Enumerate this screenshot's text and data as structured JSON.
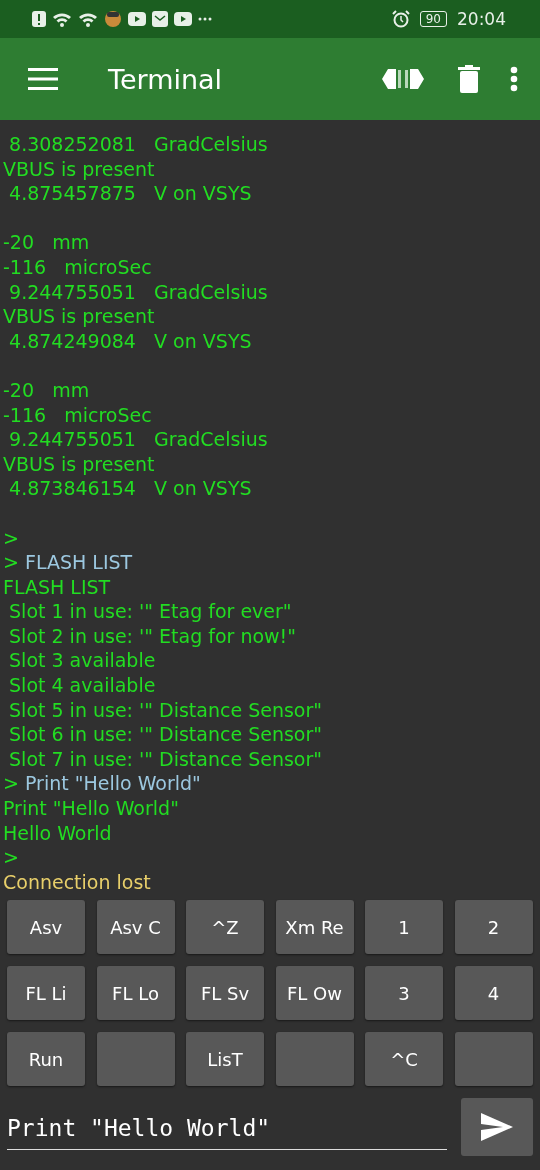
{
  "status_bar": {
    "time": "20:04",
    "battery": "90"
  },
  "app_bar": {
    "title": "Terminal"
  },
  "terminal": {
    "lines": [
      {
        "kind": "received",
        "text": " 8.308252081   GradCelsius"
      },
      {
        "kind": "received",
        "text": "VBUS is present"
      },
      {
        "kind": "received",
        "text": " 4.875457875   V on VSYS"
      },
      {
        "kind": "blank"
      },
      {
        "kind": "received",
        "text": "-20   mm"
      },
      {
        "kind": "received",
        "text": "-116   microSec"
      },
      {
        "kind": "received",
        "text": " 9.244755051   GradCelsius"
      },
      {
        "kind": "received",
        "text": "VBUS is present"
      },
      {
        "kind": "received",
        "text": " 4.874249084   V on VSYS"
      },
      {
        "kind": "blank"
      },
      {
        "kind": "received",
        "text": "-20   mm"
      },
      {
        "kind": "received",
        "text": "-116   microSec"
      },
      {
        "kind": "received",
        "text": " 9.244755051   GradCelsius"
      },
      {
        "kind": "received",
        "text": "VBUS is present"
      },
      {
        "kind": "received",
        "text": " 4.873846154   V on VSYS"
      },
      {
        "kind": "blank"
      },
      {
        "kind": "received",
        "text": ">"
      },
      {
        "kind": "sent",
        "prompt": ">",
        "text": "FLASH LIST"
      },
      {
        "kind": "received",
        "text": "FLASH LIST"
      },
      {
        "kind": "received",
        "text": " Slot 1 in use: '\" Etag for ever\""
      },
      {
        "kind": "received",
        "text": " Slot 2 in use: '\" Etag for now!\""
      },
      {
        "kind": "received",
        "text": " Slot 3 available"
      },
      {
        "kind": "received",
        "text": " Slot 4 available"
      },
      {
        "kind": "received",
        "text": " Slot 5 in use: '\" Distance Sensor\""
      },
      {
        "kind": "received",
        "text": " Slot 6 in use: '\" Distance Sensor\""
      },
      {
        "kind": "received",
        "text": " Slot 7 in use: '\" Distance Sensor\""
      },
      {
        "kind": "sent",
        "prompt": ">",
        "text": "Print \"Hello World\""
      },
      {
        "kind": "received",
        "text": "Print \"Hello World\""
      },
      {
        "kind": "received",
        "text": "Hello World"
      },
      {
        "kind": "received",
        "text": ">"
      },
      {
        "kind": "status",
        "text": "Connection lost"
      }
    ]
  },
  "keys": [
    {
      "kind": "key",
      "label": "Asv"
    },
    {
      "kind": "key",
      "label": "Asv C"
    },
    {
      "kind": "key",
      "label": "^Z"
    },
    {
      "kind": "key",
      "label": "Xm Re"
    },
    {
      "kind": "key",
      "label": "1"
    },
    {
      "kind": "key",
      "label": "2"
    },
    {
      "kind": "key",
      "label": "FL Li"
    },
    {
      "kind": "key",
      "label": "FL Lo"
    },
    {
      "kind": "key",
      "label": "FL Sv"
    },
    {
      "kind": "key",
      "label": "FL Ow"
    },
    {
      "kind": "key",
      "label": "3"
    },
    {
      "kind": "key",
      "label": "4"
    },
    {
      "kind": "key",
      "label": "Run"
    },
    {
      "kind": "blank"
    },
    {
      "kind": "key",
      "label": "LisT"
    },
    {
      "kind": "blank"
    },
    {
      "kind": "key",
      "label": "^C"
    },
    {
      "kind": "blank"
    }
  ],
  "input": {
    "value": "Print \"Hello World\""
  }
}
